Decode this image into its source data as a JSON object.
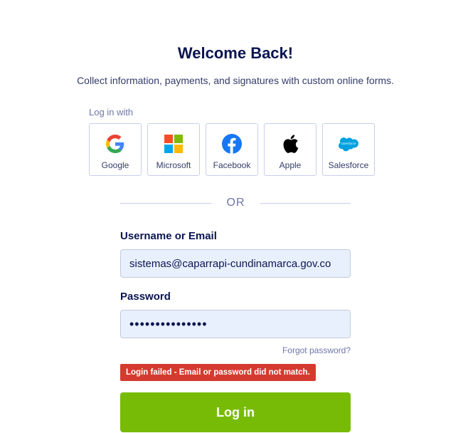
{
  "header": {
    "title": "Welcome Back!",
    "subtitle": "Collect information, payments, and signatures with custom online forms."
  },
  "social": {
    "label": "Log in with",
    "providers": [
      {
        "label": "Google",
        "icon": "google-icon"
      },
      {
        "label": "Microsoft",
        "icon": "microsoft-icon"
      },
      {
        "label": "Facebook",
        "icon": "facebook-icon"
      },
      {
        "label": "Apple",
        "icon": "apple-icon"
      },
      {
        "label": "Salesforce",
        "icon": "salesforce-icon"
      }
    ]
  },
  "divider": {
    "text": "OR"
  },
  "form": {
    "username_label": "Username or Email",
    "username_value": "sistemas@caparrapi-cundinamarca.gov.co",
    "password_label": "Password",
    "password_value": "123456789012345",
    "forgot_label": "Forgot password?",
    "error_message": "Login failed - Email or password did not match.",
    "submit_label": "Log in"
  },
  "colors": {
    "title": "#0a1551",
    "accent_green": "#78bb07",
    "error_red": "#d53a30",
    "input_bg": "#e8f0fe",
    "border": "#c8ceed"
  }
}
